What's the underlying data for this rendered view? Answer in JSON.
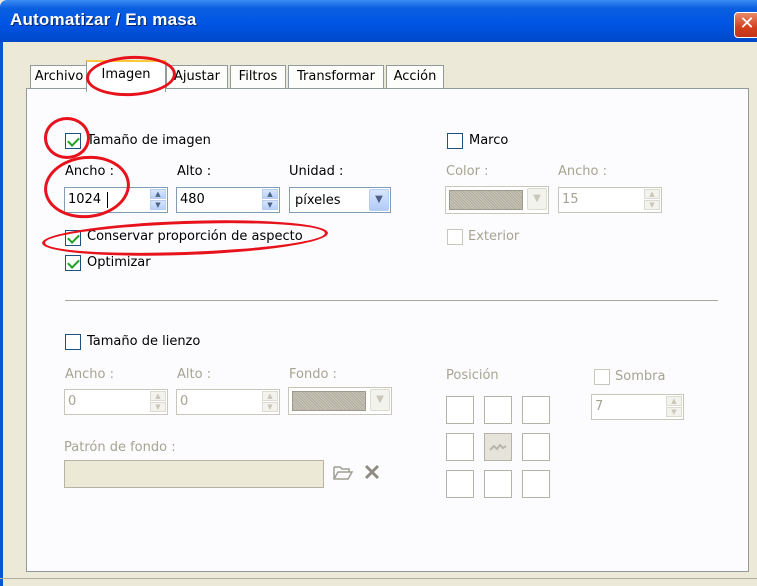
{
  "window": {
    "title": "Automatizar / En masa",
    "close_glyph": "✕"
  },
  "tabs": [
    "Archivo",
    "Imagen",
    "Ajustar",
    "Filtros",
    "Transformar",
    "Acción"
  ],
  "active_tab": "Imagen",
  "image_size": {
    "checkbox_label": "Tamaño de imagen",
    "checked": true,
    "width_label": "Ancho :",
    "width_value": "1024",
    "height_label": "Alto :",
    "height_value": "480",
    "unit_label": "Unidad :",
    "unit_value": "píxeles",
    "keep_aspect_label": "Conservar proporción de aspecto",
    "keep_aspect_checked": true,
    "optimize_label": "Optimizar",
    "optimize_checked": true
  },
  "frame": {
    "checkbox_label": "Marco",
    "checked": false,
    "color_label": "Color :",
    "width_label": "Ancho :",
    "width_value": "15",
    "outer_label": "Exterior"
  },
  "canvas": {
    "checkbox_label": "Tamaño de lienzo",
    "checked": false,
    "width_label": "Ancho :",
    "width_value": "0",
    "height_label": "Alto :",
    "height_value": "0",
    "background_label": "Fondo :",
    "position_label": "Posición",
    "shadow_label": "Sombra",
    "shadow_value": "7",
    "pattern_label": "Patrón de fondo :"
  },
  "icons": {
    "folder": "folder-open-icon",
    "delete": "delete-x-icon",
    "check": "checkmark-icon"
  },
  "colors": {
    "titlebar": "#0055e5",
    "annotation": "#e8121c",
    "active_tab_highlight": "#ffc83c"
  }
}
